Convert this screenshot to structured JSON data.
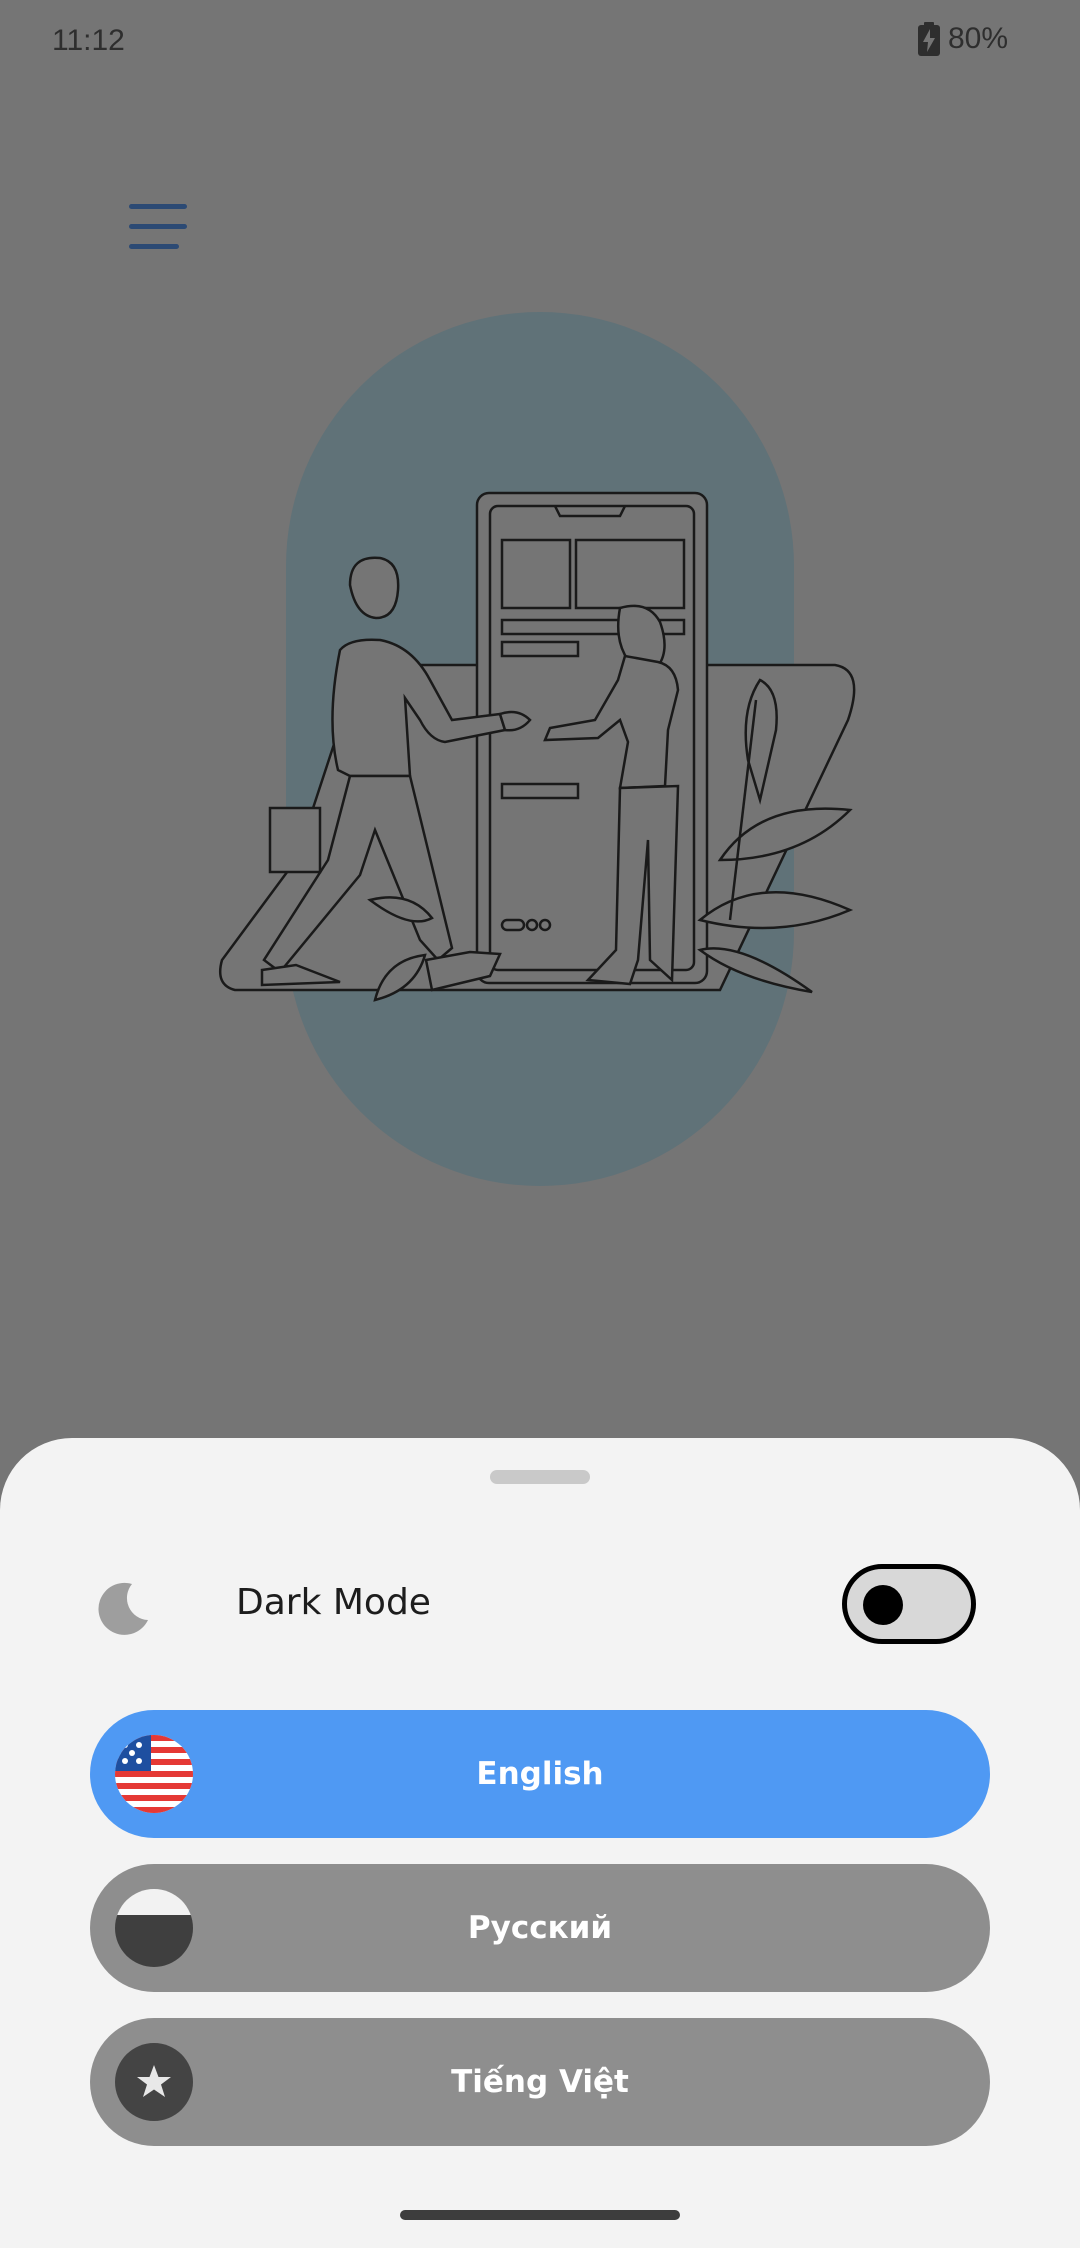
{
  "status_bar": {
    "time": "11:12",
    "battery_percent": "80%"
  },
  "menu": {
    "icon": "hamburger-menu-icon"
  },
  "illustration": {
    "subject": "handshake-with-phone-illustration"
  },
  "settings_sheet": {
    "dark_mode": {
      "icon": "moon-icon",
      "label": "Dark Mode",
      "enabled": false
    },
    "languages": [
      {
        "label": "English",
        "icon": "us-flag-icon",
        "selected": true
      },
      {
        "label": "Русский",
        "icon": "russia-flag-icon",
        "selected": false
      },
      {
        "label": "Tiếng Việt",
        "icon": "vietnam-flag-icon",
        "selected": false
      }
    ]
  },
  "colors": {
    "background_dim": "#757575",
    "sheet": "#f3f3f3",
    "selected_language": "#4f99f3",
    "unselected_language": "#8e8e8e",
    "menu_icon": "#2c4a74",
    "illustration_circle": "#607278"
  }
}
